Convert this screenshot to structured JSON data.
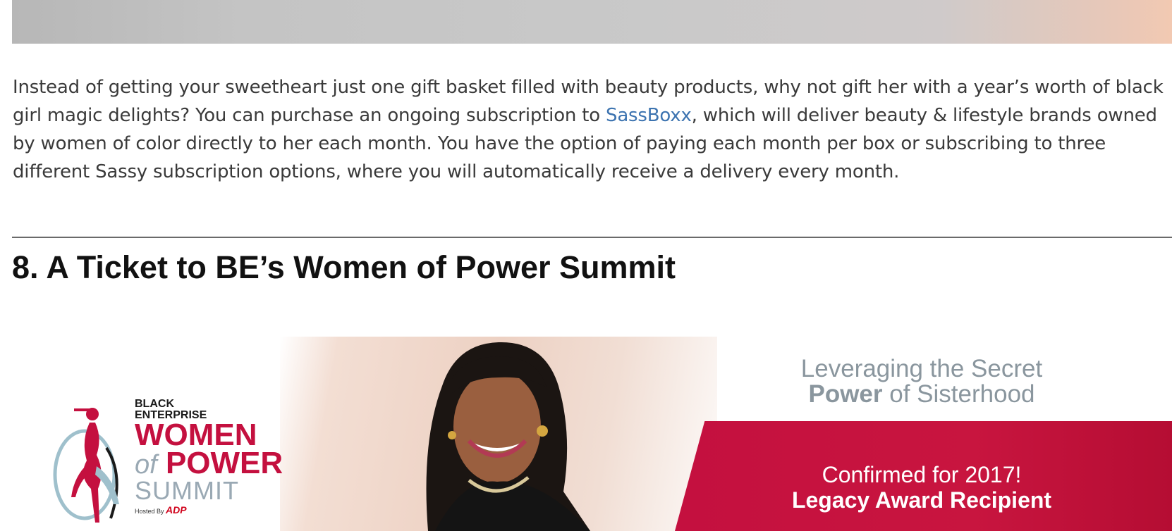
{
  "article": {
    "paragraph_before_link": "Instead of getting your sweetheart just one gift basket filled with beauty products, why not gift her with a year’s worth of black girl magic delights? You can purchase an ongoing subscription to ",
    "link_text": "SassBoxx",
    "paragraph_after_link": ", which will deliver beauty & lifestyle brands owned by women of color directly to her each month. You have the option of paying each month per box or subscribing to three different Sassy subscription options, where you will automatically receive a delivery every month."
  },
  "section": {
    "heading": "8. A Ticket to BE’s Women of Power Summit"
  },
  "promo": {
    "logo": {
      "line1": "BLACK",
      "line2": "ENTERPRISE",
      "women": "WOMEN",
      "of": "of",
      "power": "POWER",
      "summit": "SUMMIT",
      "hosted_by": "Hosted By",
      "sponsor": "ADP"
    },
    "headline_line1": "Leveraging the Secret",
    "headline_power": "Power",
    "headline_rest": " of Sisterhood",
    "confirmed": "Confirmed for 2017!",
    "award": "Legacy Award Recipient"
  },
  "colors": {
    "link": "#3c73b0",
    "brand_red": "#c4103f",
    "text": "#3a3a3a"
  }
}
